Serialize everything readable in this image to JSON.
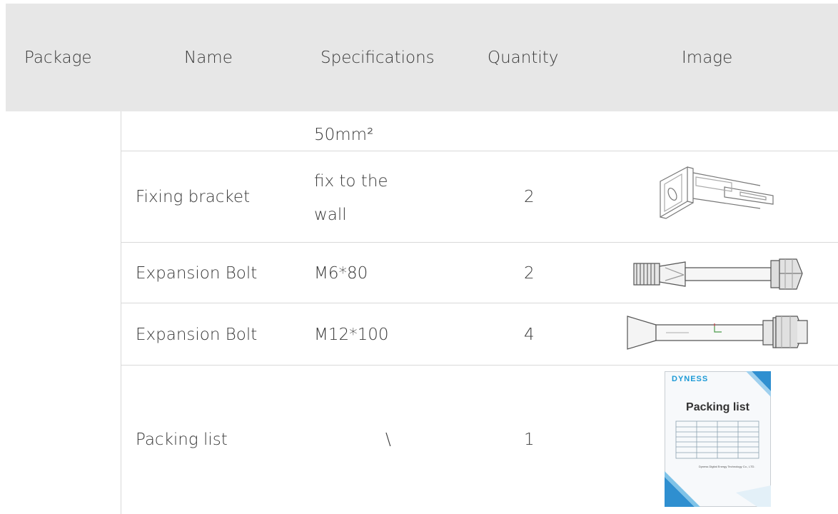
{
  "table": {
    "headers": {
      "package": "Package",
      "name": "Name",
      "specifications": "Specifications",
      "quantity": "Quantity",
      "image": "Image"
    },
    "rows": [
      {
        "name": "",
        "spec": "50mm²",
        "quantity": "",
        "image": ""
      },
      {
        "name": "Fixing bracket",
        "spec_line1": "fix to the",
        "spec_line2": "wall",
        "quantity": "2",
        "image": "fixing-bracket"
      },
      {
        "name": "Expansion Bolt",
        "spec": "M6*80",
        "quantity": "2",
        "image": "expansion-bolt-m6"
      },
      {
        "name": "Expansion Bolt",
        "spec": "M12*100",
        "quantity": "4",
        "image": "expansion-bolt-m12"
      },
      {
        "name": "Packing list",
        "spec": "\\",
        "quantity": "1",
        "image": "packing-list-booklet"
      }
    ]
  },
  "booklet": {
    "brand": "DYNESS",
    "title": "Packing list",
    "footer": "Dyness Digital Energy Technology Co., LTD."
  }
}
